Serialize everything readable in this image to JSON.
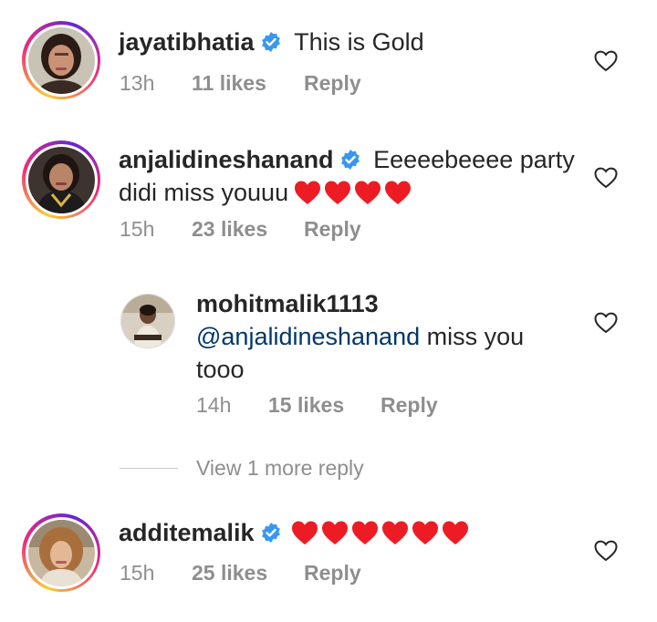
{
  "comments": [
    {
      "username": "jayatibhatia",
      "text": "This is Gold",
      "time": "13h",
      "likes": "11 likes",
      "reply": "Reply",
      "verified": true
    },
    {
      "username": "anjalidineshanand",
      "text_line1": "Eeeeebeeee party",
      "text_line2": "didi miss youuu",
      "time": "15h",
      "likes": "23 likes",
      "reply": "Reply",
      "verified": true,
      "hearts": 4
    },
    {
      "username": "mohitmalik1113",
      "mention": "@anjalidineshanand",
      "text_after": " miss you",
      "text_line2": "tooo",
      "time": "14h",
      "likes": "15 likes",
      "reply": "Reply",
      "verified": false
    },
    {
      "username": "additemalik",
      "time": "15h",
      "likes": "25 likes",
      "reply": "Reply",
      "verified": true,
      "hearts": 6
    }
  ],
  "view_more_replies": "View 1 more reply",
  "colors": {
    "text": "#262626",
    "meta": "#8e8e8e",
    "mention": "#00376b",
    "verified": "#3897f0",
    "heart": "#ed1c24"
  },
  "icons": {
    "verified": "verified-badge-icon",
    "like": "heart-outline-icon",
    "emoji": "red-heart-emoji"
  }
}
